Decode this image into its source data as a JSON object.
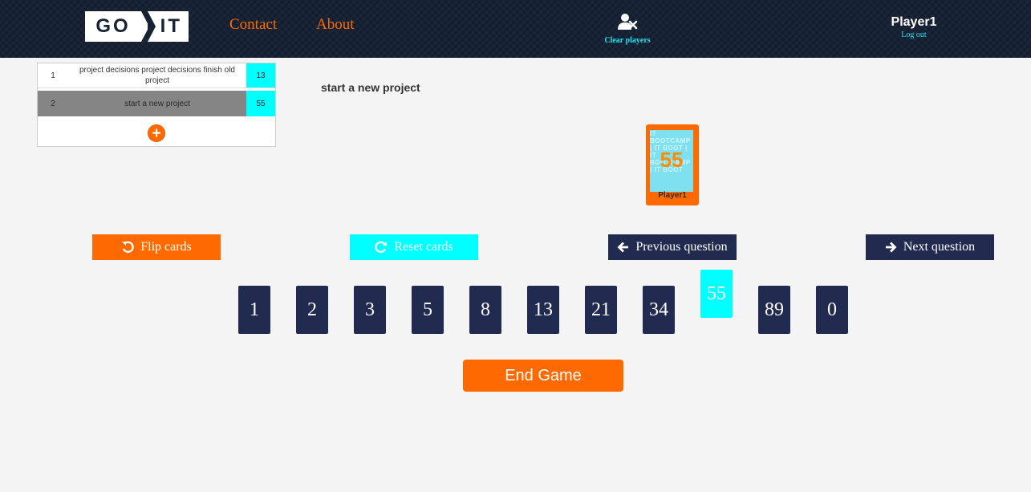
{
  "header": {
    "logo_left": "GO",
    "logo_right": "IT",
    "nav": [
      {
        "label": "Contact"
      },
      {
        "label": "About"
      }
    ],
    "clear_players_label": "Clear players",
    "user": {
      "name": "Player1",
      "logout_label": "Log out"
    }
  },
  "questions": [
    {
      "number": "1",
      "text": "project decisions project decisions finish old project",
      "score": "13"
    },
    {
      "number": "2",
      "text": "start a new project",
      "score": "55"
    }
  ],
  "add_question_symbol": "+",
  "current_question": "start a new project",
  "player_card": {
    "value": "55",
    "player": "Player1",
    "pattern_text": "IT BOOTCAMP | IT BOOT | IT BOOTCAMP | IT BOOT"
  },
  "controls": {
    "flip_label": "Flip cards",
    "reset_label": "Reset cards",
    "prev_label": "Previous question",
    "next_label": "Next question"
  },
  "cards": [
    "1",
    "2",
    "3",
    "5",
    "8",
    "13",
    "21",
    "34",
    "55",
    "89",
    "0"
  ],
  "selected_card": "55",
  "end_game_label": "End Game",
  "colors": {
    "header_bg": "#172235",
    "accent_orange": "#ff6a00",
    "accent_cyan": "#00ffff",
    "card_navy": "#212a4f"
  }
}
